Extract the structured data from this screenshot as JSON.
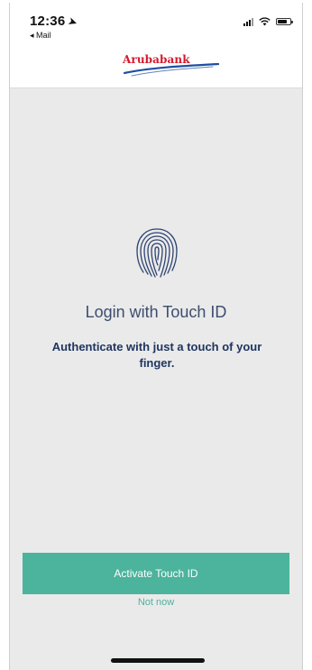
{
  "status_bar": {
    "time": "12:36",
    "back_app": "◂ Mail",
    "battery_level_fraction": 0.8
  },
  "header": {
    "logo_text": "Arubabank"
  },
  "main": {
    "title": "Login with Touch ID",
    "subtitle": "Authenticate with just a touch of your finger."
  },
  "actions": {
    "activate_label": "Activate Touch ID",
    "not_now_label": "Not now"
  },
  "icons": {
    "fingerprint": "fingerprint-icon",
    "location": "location-arrow-icon",
    "signal": "signal-icon",
    "wifi": "wifi-icon",
    "battery": "battery-icon"
  },
  "colors": {
    "accent": "#4cb39c",
    "title_text": "#3d4d6e",
    "subtitle_text": "#1f3560",
    "logo_red": "#d51a2d",
    "logo_blue": "#1e4fa1",
    "screen_bg": "#eaeaea"
  }
}
